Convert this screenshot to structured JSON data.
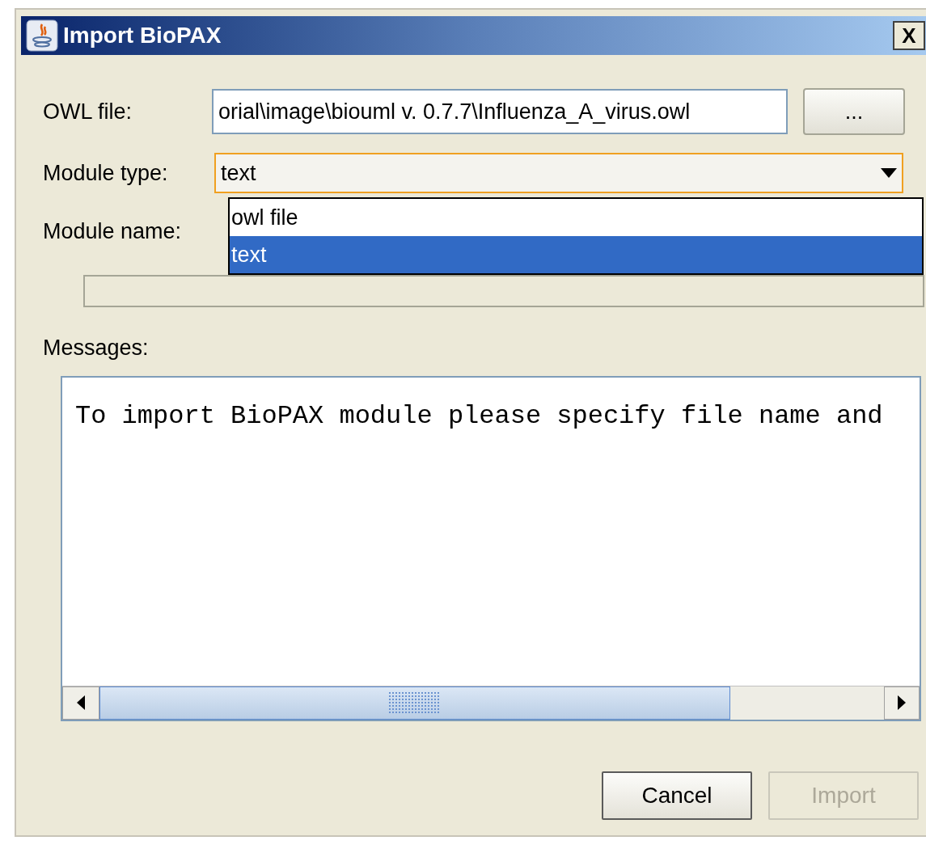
{
  "window": {
    "title": "Import BioPAX",
    "close_label": "X"
  },
  "owl_file": {
    "label": "OWL file:",
    "value": "orial\\image\\biouml v. 0.7.7\\Influenza_A_virus.owl",
    "browse_label": "..."
  },
  "module_type": {
    "label": "Module type:",
    "value": "text",
    "focused": true,
    "options": [
      {
        "label": "owl file",
        "selected": false
      },
      {
        "label": "text",
        "selected": true
      }
    ]
  },
  "module_name": {
    "label": "Module name:"
  },
  "progress": {
    "level": 0
  },
  "messages": {
    "label": "Messages:",
    "text": "To import BioPAX module please specify file name and"
  },
  "buttons": [
    {
      "label": "Cancel",
      "disabled": false
    },
    {
      "label": "Import",
      "disabled": true
    }
  ]
}
